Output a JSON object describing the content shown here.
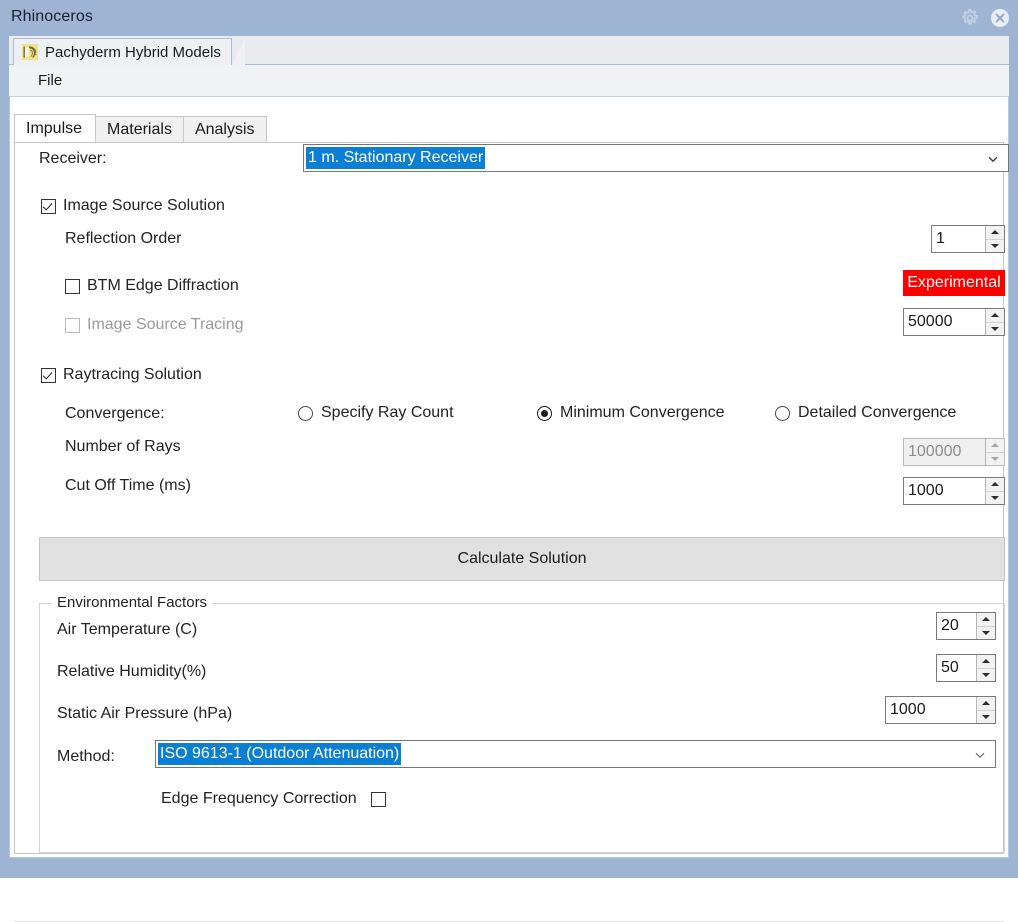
{
  "window": {
    "title": "Rhinoceros",
    "controls": [
      {
        "name": "settings-gear",
        "icon": "gear-icon",
        "label": "Settings"
      },
      {
        "name": "close",
        "icon": "close-icon",
        "label": "Close"
      }
    ]
  },
  "document_tab": {
    "label": "Pachyderm Hybrid Models",
    "icon": "pachyderm-elephant-icon"
  },
  "menubar": {
    "items": [
      {
        "label": "File"
      }
    ]
  },
  "tabs": [
    {
      "label": "Impulse",
      "active": true
    },
    {
      "label": "Materials",
      "active": false
    },
    {
      "label": "Analysis",
      "active": false
    }
  ],
  "impulse": {
    "receiver": {
      "label": "Receiver:",
      "value": "1 m. Stationary Receiver",
      "arrow_icon": "chevron-down-icon"
    },
    "image_source_solution": {
      "label": "Image Source Solution",
      "checked": true
    },
    "reflection_order": {
      "label": "Reflection Order",
      "value": "1"
    },
    "btm_edge_diffraction": {
      "label": "BTM Edge Diffraction",
      "checked": false
    },
    "experimental_badge": {
      "label": "Experimental",
      "color": "#fe0000"
    },
    "image_source_tracing": {
      "label": "Image Source Tracing",
      "checked": false,
      "enabled": false
    },
    "image_source_tracing_count": {
      "value": "50000"
    },
    "raytracing_solution": {
      "label": "Raytracing Solution",
      "checked": true
    },
    "convergence": {
      "label": "Convergence:",
      "options": [
        {
          "label": "Specify Ray Count",
          "selected": false
        },
        {
          "label": "Minimum Convergence",
          "selected": true
        },
        {
          "label": "Detailed Convergence",
          "selected": false
        }
      ]
    },
    "number_of_rays": {
      "label": "Number of Rays",
      "value": "100000",
      "enabled": false
    },
    "cut_off_time": {
      "label": "Cut Off Time (ms)",
      "value": "1000",
      "enabled": true
    },
    "calculate_button": {
      "label": "Calculate Solution"
    },
    "environmental_factors": {
      "title": "Environmental Factors",
      "air_temperature": {
        "label": "Air Temperature (C)",
        "value": "20"
      },
      "relative_humidity": {
        "label": "Relative Humidity(%)",
        "value": "50"
      },
      "static_air_pressure": {
        "label": "Static Air Pressure (hPa)",
        "value": "1000"
      },
      "method": {
        "label": "Method:",
        "value": "ISO 9613-1 (Outdoor Attenuation)",
        "arrow_icon": "chevron-down-icon"
      },
      "edge_frequency_correction": {
        "label": "Edge Frequency Correction",
        "checked": false
      }
    }
  },
  "theme": {
    "titlebar": "#9db5d3",
    "selection_blue": "#0b7fd4",
    "experimental_red": "#fe0000",
    "button_face": "#e1e1e1"
  }
}
